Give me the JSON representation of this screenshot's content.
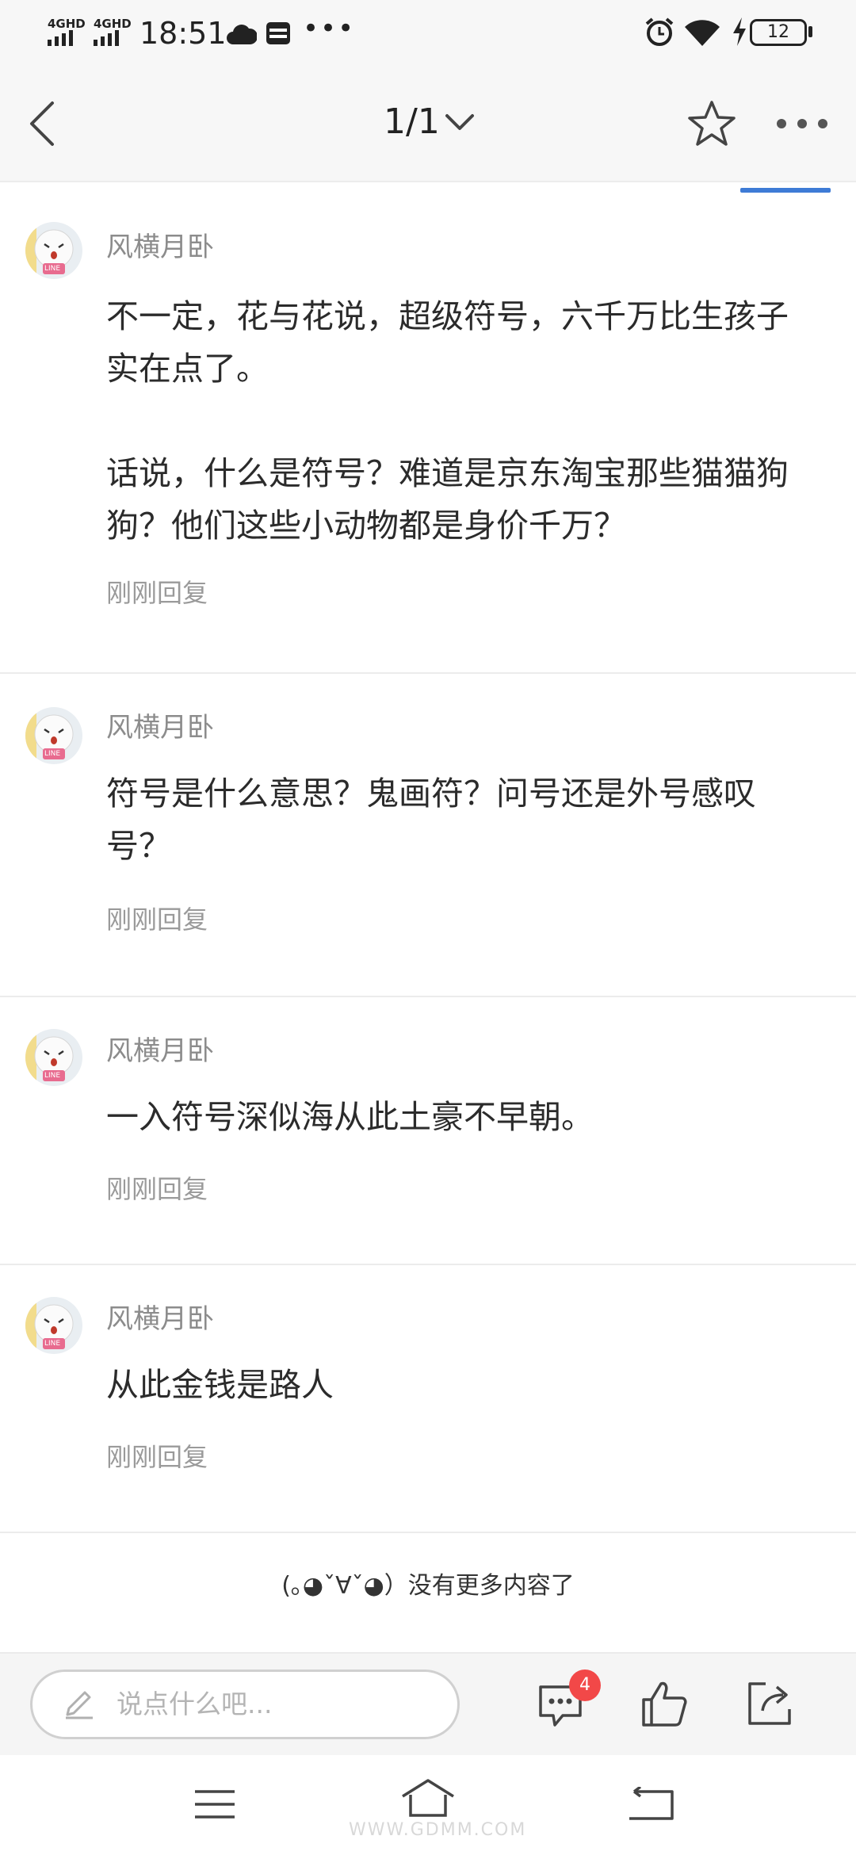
{
  "status_bar": {
    "network_1": "4GHD",
    "network_2": "4GHD",
    "time": "18:51",
    "overflow": "•••",
    "battery": "12",
    "icons": [
      "signal-icon",
      "cloud-icon",
      "card-icon",
      "alarm-icon",
      "wifi-icon",
      "charging-icon",
      "battery-icon"
    ]
  },
  "nav": {
    "back_icon": "chevron-left-icon",
    "title": "1/1",
    "dropdown_icon": "chevron-down-icon",
    "favorite_icon": "star-icon",
    "more_icon": "more-dots-icon",
    "accent_color": "#3e7bd6"
  },
  "comments": [
    {
      "username": "风横月卧",
      "content": "不一定，花与花说，超级符号，六千万比生孩子实在点了。\n\n话说，什么是符号？难道是京东淘宝那些猫猫狗狗？他们这些小动物都是身价千万？",
      "reply_time": "刚刚回复",
      "avatar_badge": "LINE"
    },
    {
      "username": "风横月卧",
      "content": "符号是什么意思？鬼画符？问号还是外号感叹号？",
      "reply_time": "刚刚回复",
      "avatar_badge": "LINE"
    },
    {
      "username": "风横月卧",
      "content": "一入符号深似海从此土豪不早朝。",
      "reply_time": "刚刚回复",
      "avatar_badge": "LINE"
    },
    {
      "username": "风横月卧",
      "content": "从此金钱是路人",
      "reply_time": "刚刚回复",
      "avatar_badge": "LINE"
    }
  ],
  "footer": {
    "no_more": "(｡◕ˇ∀ˇ◕）没有更多内容了"
  },
  "action_bar": {
    "input_placeholder": "说点什么吧...",
    "pencil_icon": "pencil-icon",
    "comments_icon": "comments-icon",
    "comment_count": "4",
    "like_icon": "thumbs-up-icon",
    "share_icon": "share-icon",
    "badge_color": "#f24848"
  },
  "system_nav": {
    "menu_icon": "menu-icon",
    "home_icon": "home-icon",
    "back_icon": "back-icon"
  },
  "watermark": "WWW.GDMM.COM"
}
